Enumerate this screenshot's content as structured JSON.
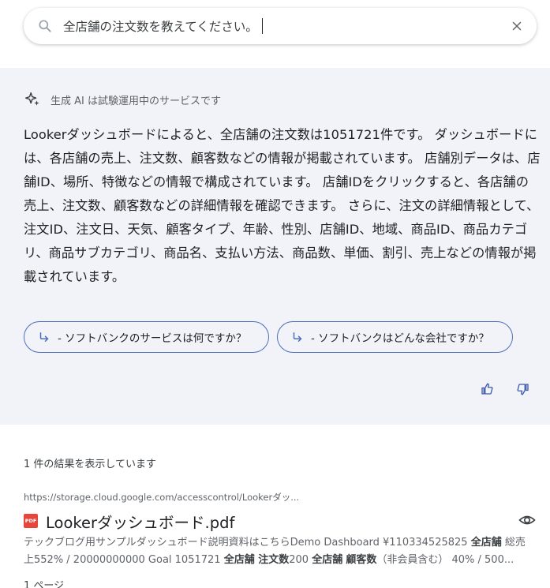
{
  "search": {
    "query": "全店舗の注文数を教えてください。"
  },
  "ai_overview": {
    "disclaimer": "生成 AI は試験運用中のサービスです",
    "answer": "Lookerダッシュボードによると、全店舗の注文数は1051721件です。 ダッシュボードには、各店舗の売上、注文数、顧客数などの情報が掲載されています。 店舗別データは、店舗ID、場所、特徴などの情報で構成されています。 店舗IDをクリックすると、各店舗の売上、注文数、顧客数などの詳細情報を確認できます。 さらに、注文の詳細情報として、注文ID、注文日、天気、顧客タイプ、年齢、性別、店舗ID、地域、商品ID、商品カテゴリ、商品サブカテゴリ、商品名、支払い方法、商品数、単価、割引、売上などの情報が掲載されています。",
    "followups": [
      "- ソフトバンクのサービスは何ですか？",
      "- ソフトバンクはどんな会社ですか？"
    ],
    "accent_color": "#4a6fb8"
  },
  "results": {
    "count_text": "1 件の結果を表示しています",
    "items": [
      {
        "url": "https://storage.cloud.google.com/accesscontrol/Lookerダッ...",
        "file_badge": "PDF",
        "title": "Lookerダッシュボード.pdf",
        "snippet_parts": [
          {
            "text": "テックブログ用サンプルダッシュボード説明資料はこちらDemo Dashboard ¥110334525825 ",
            "bold": false
          },
          {
            "text": "全店舗",
            "bold": true
          },
          {
            "text": " 総売上552% / 20000000000 Goal 1051721 ",
            "bold": false
          },
          {
            "text": "全店舗 注文数",
            "bold": true
          },
          {
            "text": "200 ",
            "bold": false
          },
          {
            "text": "全店舗",
            "bold": true
          },
          {
            "text": " ",
            "bold": false
          },
          {
            "text": "顧客数",
            "bold": true
          },
          {
            "text": "（非会員含む） 40% / 500...",
            "bold": false
          }
        ],
        "pages": "1 ページ"
      }
    ]
  },
  "icons": {
    "search": "search-icon",
    "clear": "close-icon",
    "sparkle": "sparkle-icon",
    "followup_arrow": "subdirectory-arrow-icon",
    "thumbs_up": "thumbs-up-icon",
    "thumbs_down": "thumbs-down-icon",
    "preview": "eye-icon",
    "file": "pdf-icon"
  }
}
